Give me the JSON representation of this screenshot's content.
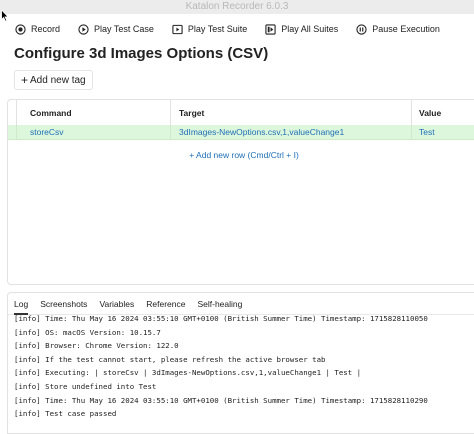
{
  "window": {
    "title": "Katalon Recorder 6.0.3"
  },
  "toolbar": {
    "record": "Record",
    "play_test_case": "Play Test Case",
    "play_test_suite": "Play Test Suite",
    "play_all_suites": "Play All Suites",
    "pause_execution": "Pause Execution"
  },
  "page": {
    "title": "Configure 3d Images Options (CSV)"
  },
  "tag_button": {
    "label": "Add new tag"
  },
  "table": {
    "columns": [
      "Command",
      "Target",
      "Value"
    ],
    "rows": [
      {
        "command": "storeCsv",
        "target": "3dImages-NewOptions.csv,1,valueChange1",
        "value": "Test"
      }
    ],
    "add_row": "+ Add new row (Cmd/Ctrl + I)"
  },
  "log_tabs": [
    "Log",
    "Screenshots",
    "Variables",
    "Reference",
    "Self-healing"
  ],
  "log_lines": [
    "[info] Time: Thu May 16 2024 03:55:10 GMT+0100 (British Summer Time) Timestamp: 1715828110050",
    "[info] OS: macOS Version: 10.15.7",
    "[info] Browser: Chrome Version: 122.0",
    "[info] If the test cannot start, please refresh the active browser tab",
    "[info] Executing: | storeCsv | 3dImages-NewOptions.csv,1,valueChange1 | Test |",
    "[info] Store undefined into Test",
    "[info] Time: Thu May 16 2024 03:55:10 GMT+0100 (British Summer Time) Timestamp: 1715828110290",
    "[info] Test case passed"
  ],
  "icons": {
    "record": "record-icon",
    "play_test_case": "play-circle-icon",
    "play_test_suite": "play-suite-icon",
    "play_all_suites": "play-all-icon",
    "pause_execution": "pause-circle-icon"
  }
}
